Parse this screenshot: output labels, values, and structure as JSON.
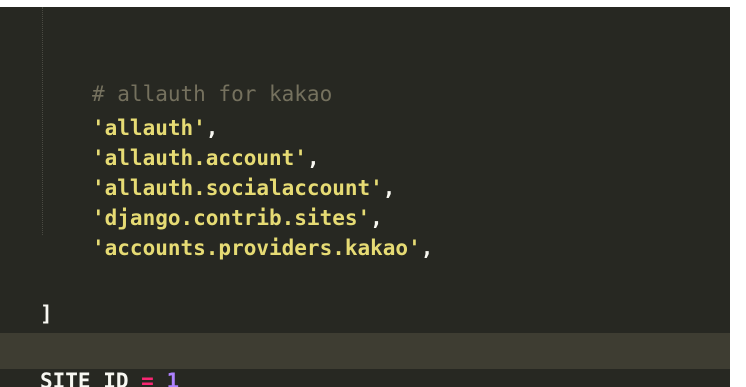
{
  "partial_top_line": "_",
  "lines": [
    {
      "comment": "# allauth for kakao"
    },
    {
      "string": "'allauth'",
      "punct": ","
    },
    {
      "string": "'allauth.account'",
      "punct": ","
    },
    {
      "string": "'allauth.socialaccount'",
      "punct": ","
    },
    {
      "string": "'django.contrib.sites'",
      "punct": ","
    },
    {
      "string": "'accounts.providers.kakao'",
      "punct": ","
    }
  ],
  "closing_bracket": "]",
  "assignment": {
    "name": "SITE_ID",
    "operator": "=",
    "value": "1"
  },
  "colors": {
    "background": "#272822",
    "current_line": "#3e3d32",
    "comment": "#75715e",
    "string": "#e6db74",
    "operator": "#f92672",
    "number": "#ae81ff",
    "text": "#f8f8f2"
  }
}
